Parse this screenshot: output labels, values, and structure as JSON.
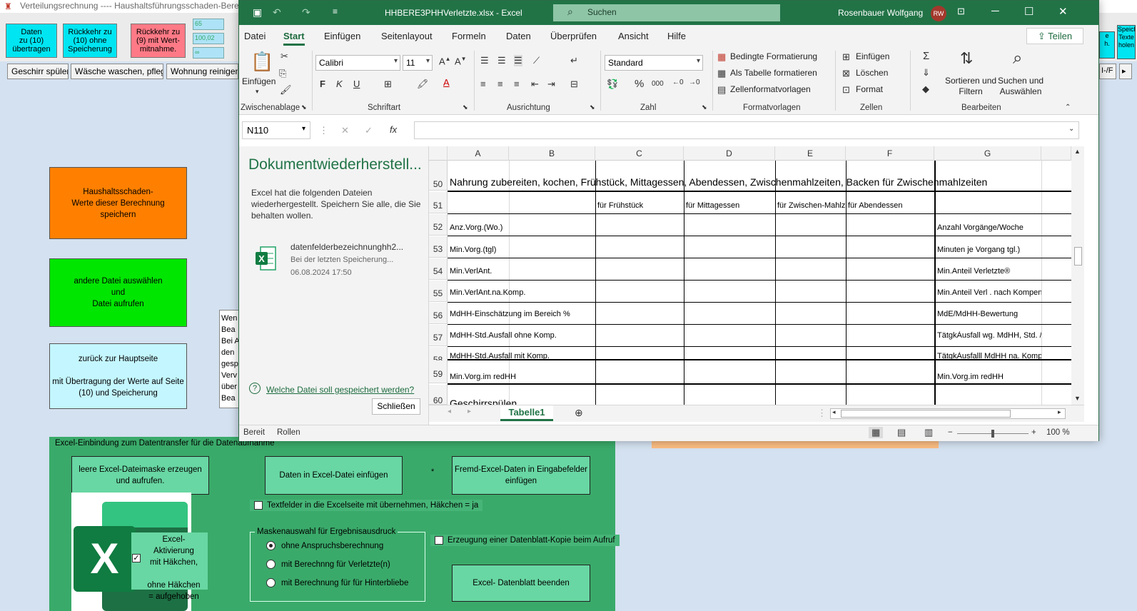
{
  "bg_app": {
    "title": "Verteilungsrechnung  ---- Haushaltsführungsschaden-Berechnung",
    "top_buttons": [
      {
        "label": "Daten\nzu (10)\nübertragen",
        "color": "#00e5f2"
      },
      {
        "label": "Rückkehr zu\n(10) ohne\nSpeicherung",
        "color": "#00e5f2"
      },
      {
        "label": "Rückkehr zu\n(9) mit Wert-\nmitnahme.",
        "color": "#ff7a86"
      }
    ],
    "mini_values": [
      "65",
      "100,02",
      "∞"
    ],
    "tabs": [
      "Geschirr spülen",
      "Wäsche waschen, pflegen",
      "Wohnung reinigen,"
    ],
    "right_tab": "I-/F",
    "big_buttons": [
      {
        "label": "Haushaltsschaden-\nWerte dieser Berechnung\nspeichern",
        "color": "#ff8000"
      },
      {
        "label": "andere Datei auswählen\nund\nDatei aufrufen",
        "color": "#00e600"
      },
      {
        "label": "zurück zur Hauptseite\n\nmit Übertragung der Werte auf Seite\n(10) und  Speicherung",
        "color": "#c4f6ff"
      }
    ],
    "note_text": "Wen\nBea\nBei A\nden\ngesp\nVerv\nüber\nBea",
    "right_side_buttons": [
      {
        "label": "e\nh.",
        "color": "#00e5f2"
      },
      {
        "label": "Speich\nTexte\nholen",
        "color": "#00e5f2"
      }
    ],
    "excel_panel": {
      "title": "Excel-Einbindung zum Datentransfer für die Datenaufnahme",
      "btn_create": "leere Excel-Dateimaske erzeugen\nund aufrufen.",
      "btn_insert": "Daten in Excel-Datei einfügen",
      "star": "*",
      "btn_foreign": "Fremd-Excel-Daten in Eingabefelder\neinfügen",
      "cb_textfields": "Textfelder in die Excelseite mit übernehmen, Häkchen = ja",
      "cb_copy": "Erzeugung einer Datenblatt-Kopie beim Aufruf",
      "activation": "Excel-Aktivierung\nmit Häkchen,\n\nohne Häkchen\n=  aufgehoben",
      "activation_check": "✓",
      "logo_letter": "X",
      "mask_group_title": "Maskenauswahl für Ergebnisausdruck",
      "radios": [
        "ohne Anspruchsberechnung",
        "mit Berechnng für Verletzte(n)",
        "mit Berechnung für für Hinterbliebe"
      ],
      "radio_selected": 0,
      "btn_end": "Excel- Datenblatt beenden"
    }
  },
  "excel": {
    "filename": "HHBERE3PHHVerletzte.xlsx  -  Excel",
    "search": "Suchen",
    "user": "Rosenbauer Wolfgang",
    "avatar": "RW",
    "menu": [
      "Datei",
      "Start",
      "Einfügen",
      "Seitenlayout",
      "Formeln",
      "Daten",
      "Überprüfen",
      "Ansicht",
      "Hilfe"
    ],
    "active_menu": "Start",
    "share": "Teilen",
    "ribbon": {
      "paste": "Einfügen",
      "clipboard": "Zwischenablage",
      "font": "Calibri",
      "font_size": "11",
      "bold": "F",
      "italic": "K",
      "underline": "U",
      "font_group": "Schriftart",
      "align_group": "Ausrichtung",
      "number_format": "Standard",
      "percent": "%",
      "thousands": "000",
      "number_group": "Zahl",
      "cond_format": "Bedingte Formatierung",
      "as_table": "Als Tabelle formatieren",
      "cell_styles": "Zellenformatvorlagen",
      "styles_group": "Formatvorlagen",
      "insert": "Einfügen",
      "delete": "Löschen",
      "format": "Format",
      "cells_group": "Zellen",
      "sort_filter": "Sortieren und\nFiltern",
      "find_select": "Suchen und\nAuswählen",
      "edit_group": "Bearbeiten"
    },
    "name_box": "N110",
    "fx": "fx",
    "doc_recovery": {
      "title": "Dokumentwiederherstell...",
      "text": "Excel hat die folgenden Dateien wiederhergestellt. Speichern Sie alle, die Sie behalten wollen.",
      "file_name": "datenfelderbezeichnunghh2...",
      "file_sub": "Bei der letzten Speicherung...",
      "file_date": "06.08.2024 17:50",
      "question": "Welche Datei soll gespeichert werden?",
      "close": "Schließen"
    },
    "columns": [
      "A",
      "B",
      "C",
      "D",
      "E",
      "F",
      "G"
    ],
    "rows": [
      {
        "num": "50",
        "a": "Nahrung zubereiten, kochen, Frühstück, Mittagessen, Abendessen, Zwischenmahlzeiten, Backen für Zwischenmahlzeiten",
        "c": "",
        "d": "",
        "e": "",
        "f": "",
        "g": ""
      },
      {
        "num": "51",
        "a": "",
        "c": "für Frühstück",
        "d": "für Mittagessen",
        "e": "für Zwischen-Mahlzeiten",
        "f": "für Abendessen",
        "g": ""
      },
      {
        "num": "52",
        "a": "Anz.Vorg.(Wo.)",
        "c": "",
        "d": "",
        "e": "",
        "f": "",
        "g": "Anzahl Vorgänge/Woche"
      },
      {
        "num": "53",
        "a": "Min.Vorg.(tgl)",
        "c": "",
        "d": "",
        "e": "",
        "f": "",
        "g": "Minuten je Vorgang tgl.)"
      },
      {
        "num": "54",
        "a": "Min.VerlAnt.",
        "c": "",
        "d": "",
        "e": "",
        "f": "",
        "g": "Min.Anteil Verletzte®"
      },
      {
        "num": "55",
        "a": "Min.VerlAnt.na.Komp.",
        "c": "",
        "d": "",
        "e": "",
        "f": "",
        "g": "Min.Anteil Verl . nach Kompension"
      },
      {
        "num": "56",
        "a": "MdHH-Einschätzung im Bereich %",
        "c": "",
        "d": "",
        "e": "",
        "f": "",
        "g": "MdE/MdHH-Bewertung"
      },
      {
        "num": "57",
        "a": "MdHH-Std.Ausfall ohne Komp.",
        "c": "",
        "d": "",
        "e": "",
        "f": "",
        "g": "TätgkÀusfall wg. MdHH, Std. /Wo"
      },
      {
        "num": "58",
        "a": "MdHH-Std.Ausfall mit Komp.",
        "c": "",
        "d": "",
        "e": "",
        "f": "",
        "g": "TätgkÀusfalll MdHH na. Kompens."
      },
      {
        "num": "59",
        "a": "Min.Vorg.im redHH",
        "c": "",
        "d": "",
        "e": "",
        "f": "",
        "g": "Min.Vorg.im redHH"
      },
      {
        "num": "60",
        "a": "Geschirrspülen",
        "c": "",
        "d": "",
        "e": "",
        "f": "",
        "g": ""
      }
    ],
    "sheet_tab": "Tabelle1",
    "status": {
      "ready": "Bereit",
      "scroll": "Rollen",
      "zoom": "100 %"
    }
  }
}
